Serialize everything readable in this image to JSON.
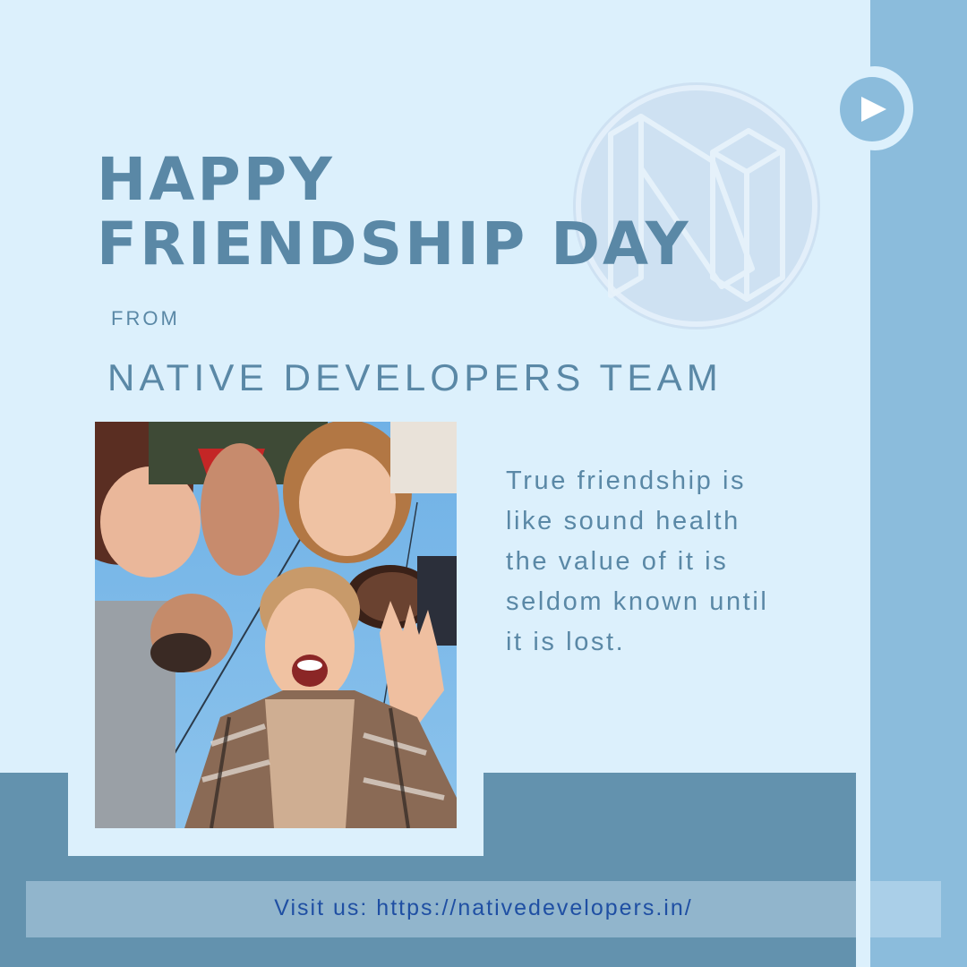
{
  "headline": {
    "line1": "HAPPY",
    "line2": "FRIENDSHIP DAY"
  },
  "from_label": "FROM",
  "team_name": "NATIVE DEVELOPERS TEAM",
  "quote": {
    "lines": [
      "True friendship is",
      "like sound health",
      "the value of it is",
      "seldom known until",
      "it is lost."
    ]
  },
  "visit": "Visit us: https://nativedevelopers.in/",
  "icons": {
    "logo": "native-developers-logo-icon",
    "play": "play-icon"
  },
  "colors": {
    "background": "#dcf0fc",
    "accent_stripe": "#8bbcdc",
    "bottom_band": "#6392ae",
    "heading_text": "#5a88a6",
    "link_text": "#1f4fa3"
  }
}
